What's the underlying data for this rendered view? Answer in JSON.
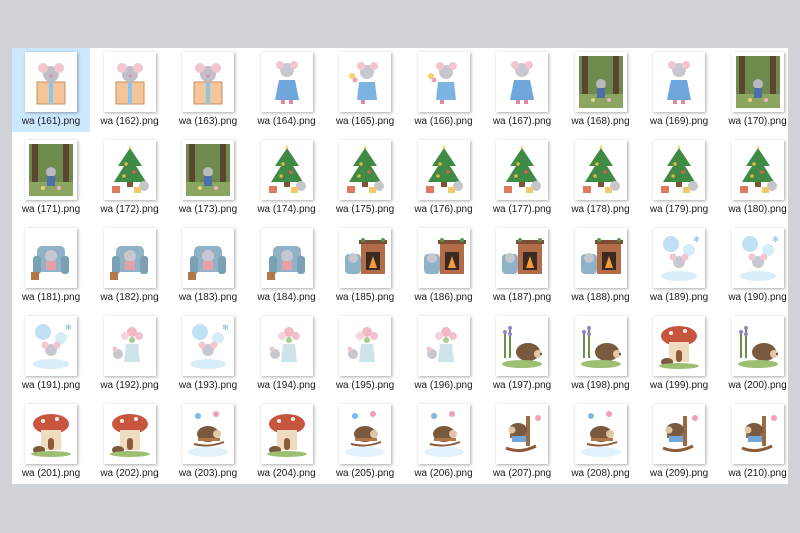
{
  "files": [
    {
      "name": "wa (161).png",
      "icon": "mouse-in-gift-box-icon",
      "selected": true
    },
    {
      "name": "wa (162).png",
      "icon": "mouse-in-gift-box-icon"
    },
    {
      "name": "wa (163).png",
      "icon": "mouse-in-gift-box-icon"
    },
    {
      "name": "wa (164).png",
      "icon": "mouse-blue-dress-icon"
    },
    {
      "name": "wa (165).png",
      "icon": "mouse-with-flowers-icon"
    },
    {
      "name": "wa (166).png",
      "icon": "mouse-with-flowers-icon"
    },
    {
      "name": "wa (167).png",
      "icon": "mouse-blue-dress-icon"
    },
    {
      "name": "wa (168).png",
      "icon": "forest-scene-icon"
    },
    {
      "name": "wa (169).png",
      "icon": "mouse-blue-dress-icon"
    },
    {
      "name": "wa (170).png",
      "icon": "forest-scene-icon"
    },
    {
      "name": "wa (171).png",
      "icon": "forest-scene-icon"
    },
    {
      "name": "wa (172).png",
      "icon": "christmas-tree-mouse-icon"
    },
    {
      "name": "wa (173).png",
      "icon": "forest-scene-icon"
    },
    {
      "name": "wa (174).png",
      "icon": "christmas-tree-mouse-icon"
    },
    {
      "name": "wa (175).png",
      "icon": "christmas-tree-mouse-icon"
    },
    {
      "name": "wa (176).png",
      "icon": "christmas-tree-mouse-icon"
    },
    {
      "name": "wa (177).png",
      "icon": "christmas-tree-mouse-icon"
    },
    {
      "name": "wa (178).png",
      "icon": "christmas-tree-mouse-icon"
    },
    {
      "name": "wa (179).png",
      "icon": "christmas-tree-mouse-icon"
    },
    {
      "name": "wa (180).png",
      "icon": "christmas-tree-mouse-icon"
    },
    {
      "name": "wa (181).png",
      "icon": "armchair-mouse-icon"
    },
    {
      "name": "wa (182).png",
      "icon": "armchair-mouse-icon"
    },
    {
      "name": "wa (183).png",
      "icon": "armchair-mouse-icon"
    },
    {
      "name": "wa (184).png",
      "icon": "armchair-mouse-icon"
    },
    {
      "name": "wa (185).png",
      "icon": "fireplace-mouse-icon"
    },
    {
      "name": "wa (186).png",
      "icon": "fireplace-mouse-icon"
    },
    {
      "name": "wa (187).png",
      "icon": "fireplace-mouse-icon"
    },
    {
      "name": "wa (188).png",
      "icon": "fireplace-mouse-icon"
    },
    {
      "name": "wa (189).png",
      "icon": "snow-mouse-icon"
    },
    {
      "name": "wa (190).png",
      "icon": "snow-mouse-icon"
    },
    {
      "name": "wa (191).png",
      "icon": "snow-mouse-icon"
    },
    {
      "name": "wa (192).png",
      "icon": "mouse-flower-vase-icon"
    },
    {
      "name": "wa (193).png",
      "icon": "snow-mouse-icon"
    },
    {
      "name": "wa (194).png",
      "icon": "mouse-flower-vase-icon"
    },
    {
      "name": "wa (195).png",
      "icon": "mouse-flower-vase-icon"
    },
    {
      "name": "wa (196).png",
      "icon": "mouse-flower-vase-icon"
    },
    {
      "name": "wa (197).png",
      "icon": "hedgehog-lavender-icon"
    },
    {
      "name": "wa (198).png",
      "icon": "hedgehog-lavender-icon"
    },
    {
      "name": "wa (199).png",
      "icon": "hedgehog-mushroom-house-icon"
    },
    {
      "name": "wa (200).png",
      "icon": "hedgehog-lavender-icon"
    },
    {
      "name": "wa (201).png",
      "icon": "hedgehog-mushroom-house-icon"
    },
    {
      "name": "wa (202).png",
      "icon": "hedgehog-mushroom-house-icon"
    },
    {
      "name": "wa (203).png",
      "icon": "hedgehog-sled-icon"
    },
    {
      "name": "wa (204).png",
      "icon": "hedgehog-mushroom-house-icon"
    },
    {
      "name": "wa (205).png",
      "icon": "hedgehog-sled-icon"
    },
    {
      "name": "wa (206).png",
      "icon": "hedgehog-sled-icon"
    },
    {
      "name": "wa (207).png",
      "icon": "hedgehog-rocking-chair-icon"
    },
    {
      "name": "wa (208).png",
      "icon": "hedgehog-sled-icon"
    },
    {
      "name": "wa (209).png",
      "icon": "hedgehog-rocking-chair-icon"
    },
    {
      "name": "wa (210).png",
      "icon": "hedgehog-rocking-chair-icon"
    }
  ],
  "colors": {
    "selection": "#cce8ff",
    "background": "#cfd2d6"
  }
}
